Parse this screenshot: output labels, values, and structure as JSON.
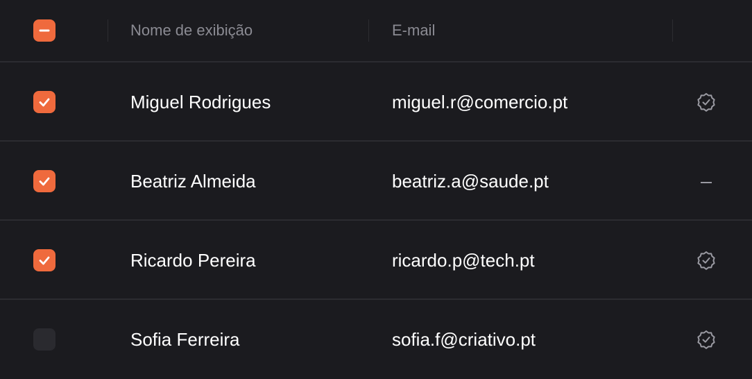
{
  "header": {
    "display_name_label": "Nome de exibição",
    "email_label": "E-mail",
    "select_all_state": "indeterminate"
  },
  "rows": [
    {
      "name": "Miguel Rodrigues",
      "email": "miguel.r@comercio.pt",
      "checked": true,
      "status_icon": "verified-badge-icon"
    },
    {
      "name": "Beatriz Almeida",
      "email": "beatriz.a@saude.pt",
      "checked": true,
      "status_icon": "dash-icon"
    },
    {
      "name": "Ricardo Pereira",
      "email": "ricardo.p@tech.pt",
      "checked": true,
      "status_icon": "verified-badge-icon"
    },
    {
      "name": "Sofia Ferreira",
      "email": "sofia.f@criativo.pt",
      "checked": false,
      "status_icon": "verified-badge-icon"
    }
  ],
  "colors": {
    "background": "#1b1b1f",
    "accent": "#ef6a3d",
    "divider": "#2c2c31",
    "header_text": "#8b8b93",
    "icon": "#9a9aa2"
  }
}
